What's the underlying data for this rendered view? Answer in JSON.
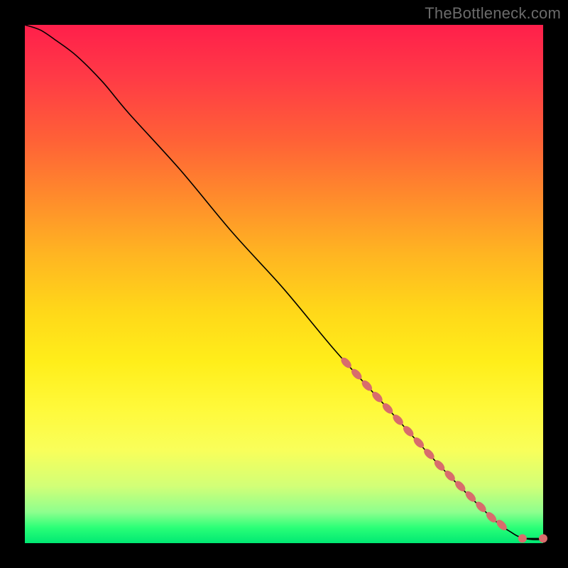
{
  "watermark": "TheBottleneck.com",
  "chart_data": {
    "type": "line",
    "title": "",
    "xlabel": "",
    "ylabel": "",
    "xlim": [
      0,
      100
    ],
    "ylim": [
      0,
      100
    ],
    "grid": false,
    "legend": false,
    "curve": {
      "x": [
        0,
        3,
        6,
        10,
        15,
        20,
        30,
        40,
        50,
        60,
        70,
        80,
        90,
        94,
        96,
        98,
        100
      ],
      "y": [
        100,
        99,
        97,
        94,
        89,
        83,
        72,
        60,
        49,
        37,
        26,
        15,
        5,
        2,
        1,
        0.7,
        0.7
      ]
    },
    "markers_on_curve_x": [
      62,
      64,
      66,
      68,
      70,
      72,
      74,
      76,
      78,
      80,
      82,
      84,
      86,
      88,
      90,
      92
    ],
    "end_markers": [
      {
        "x": 96,
        "y": 0.9
      },
      {
        "x": 100,
        "y": 0.9
      }
    ]
  }
}
